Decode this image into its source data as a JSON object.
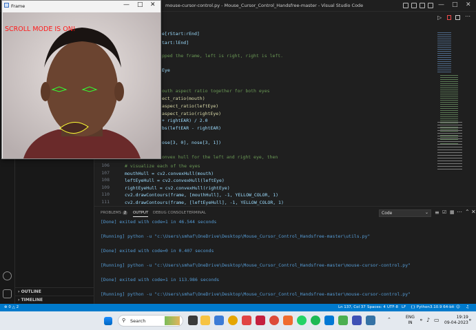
{
  "vscode": {
    "title": "mouse-cursor-control.py - Mouse_Cursor_Control_Handsfree-master - Visual Studio Code",
    "code_fragments": [
      {
        "text": "e[rStart:rEnd]",
        "cls": "tx"
      },
      {
        "text": "tart:lEnd]",
        "cls": "tx"
      },
      {
        "text": "pped the frame, left is right, right is left.",
        "cls": "cm"
      },
      {
        "text": "Eye",
        "cls": "tx"
      },
      {
        "text": "outh aspect ratio together for both eyes",
        "cls": "cm"
      },
      {
        "text": "ect_ratio(mouth)",
        "cls": "fn"
      },
      {
        "text": "aspect_ratio(leftEye)",
        "cls": "fn"
      },
      {
        "text": "aspect_ratio(rightEye)",
        "cls": "fn"
      },
      {
        "text": "+ rightEAR) / 2.0",
        "cls": "tx"
      },
      {
        "text": "bs(leftEAR - rightEAR)",
        "cls": "tx"
      },
      {
        "text": "ose[3, 0], nose[3, 1])",
        "cls": "tx"
      },
      {
        "text": "onvex hull for the left and right eye, then",
        "cls": "cm"
      }
    ],
    "code_lines": [
      {
        "num": "106",
        "text": "# visualize each of the eyes",
        "cls": "cm"
      },
      {
        "num": "107",
        "text": "mouthHull = cv2.convexHull(mouth)",
        "cls": "tx"
      },
      {
        "num": "108",
        "text": "leftEyeHull = cv2.convexHull(leftEye)",
        "cls": "tx"
      },
      {
        "num": "109",
        "text": "rightEyeHull = cv2.convexHull(rightEye)",
        "cls": "tx"
      },
      {
        "num": "110",
        "text": "cv2.drawContours(frame, [mouthHull], -1, YELLOW_COLOR, 1)",
        "cls": "tx"
      },
      {
        "num": "111",
        "text": "cv2.drawContours(frame, [leftEyeHull], -1, YELLOW_COLOR, 1)",
        "cls": "tx"
      }
    ],
    "sidebar_sections": [
      "OUTLINE",
      "TIMELINE"
    ],
    "panel": {
      "tabs": [
        "PROBLEMS",
        "OUTPUT",
        "DEBUG CONSOLE",
        "TERMINAL"
      ],
      "problems_count": "2",
      "active_tab": "OUTPUT",
      "channel": "Code",
      "output_lines": [
        {
          "kind": "done",
          "text": "[Done] exited with code=1 in 46.544 seconds"
        },
        {
          "kind": "run",
          "text": "[Running] python -u \"c:\\Users\\smhaf\\OneDrive\\Desktop\\Mouse_Cursor_Control_Handsfree-master\\utils.py\""
        },
        {
          "kind": "done",
          "text": "[Done] exited with code=0 in 0.407 seconds"
        },
        {
          "kind": "run",
          "text": "[Running] python -u \"c:\\Users\\smhaf\\OneDrive\\Desktop\\Mouse_Cursor_Control_Handsfree-master\\mouse-cursor-control.py\""
        },
        {
          "kind": "done",
          "text": "[Done] exited with code=1 in 113.986 seconds"
        },
        {
          "kind": "run",
          "text": "[Running] python -u \"c:\\Users\\smhaf\\OneDrive\\Desktop\\Mouse_Cursor_Control_Handsfree-master\\mouse-cursor-control.py\""
        }
      ]
    },
    "status": {
      "errors": "0",
      "warnings": "2",
      "position": "Ln 137, Col 37",
      "spaces": "Spaces: 4",
      "encoding": "UTF-8",
      "eol": "LF",
      "language": "Python",
      "interpreter": "3.10.9 64-bit"
    }
  },
  "frame_window": {
    "title": "Frame",
    "overlay_text": "SCROLL MODE IS ON!",
    "overlay_color": "#ff1a1a"
  },
  "taskbar": {
    "search_placeholder": "Search",
    "language": "ENG",
    "region": "IN",
    "time": "19:19",
    "date": "09-04-2023",
    "apps": [
      "start-icon",
      "widgets-icon",
      "task-view-icon",
      "file-explorer-icon",
      "store-icon",
      "chrome-icon",
      "app-icon",
      "app-icon",
      "chrome-icon",
      "whatsapp-icon",
      "spotify-icon",
      "vscode-icon",
      "app-icon",
      "chrome-icon",
      "app-icon",
      "python-icon"
    ]
  },
  "colors": {
    "accent": "#007acc",
    "editor_bg": "#1f1f1f",
    "taskbar_bg": "#e4e9ef"
  }
}
